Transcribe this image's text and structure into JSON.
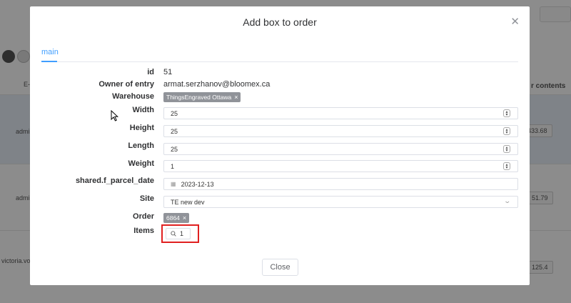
{
  "background": {
    "header_col_left": "E-",
    "header_col_right": "r contents",
    "rows": [
      {
        "user": "admi",
        "amount": "433.68"
      },
      {
        "user": "admi",
        "amount": "51.79"
      },
      {
        "user": "victoria.voro",
        "amount": "125.4"
      }
    ]
  },
  "modal": {
    "title": "Add box to order",
    "close_icon": "close-icon",
    "tabs": [
      {
        "label": "main",
        "active": true
      }
    ],
    "fields": {
      "id": {
        "label": "id",
        "value": "51"
      },
      "owner": {
        "label": "Owner of entry",
        "value": "armat.serzhanov@bloomex.ca"
      },
      "warehouse": {
        "label": "Warehouse",
        "tag": "ThingsEngraved Ottawa"
      },
      "width": {
        "label": "Width",
        "value": "25"
      },
      "height": {
        "label": "Height",
        "value": "25"
      },
      "length": {
        "label": "Length",
        "value": "25"
      },
      "weight": {
        "label": "Weight",
        "value": "1"
      },
      "parcel_date": {
        "label": "shared.f_parcel_date",
        "value": "2023-12-13"
      },
      "site": {
        "label": "Site",
        "value": "TE new dev"
      },
      "order": {
        "label": "Order",
        "tag": "6864"
      },
      "items": {
        "label": "Items",
        "value": "1"
      }
    },
    "close_button": "Close"
  },
  "colors": {
    "accent": "#409eff",
    "tag_bg": "#909399",
    "highlight": "#e02020",
    "overlay": "rgba(0,0,0,0.45)"
  }
}
